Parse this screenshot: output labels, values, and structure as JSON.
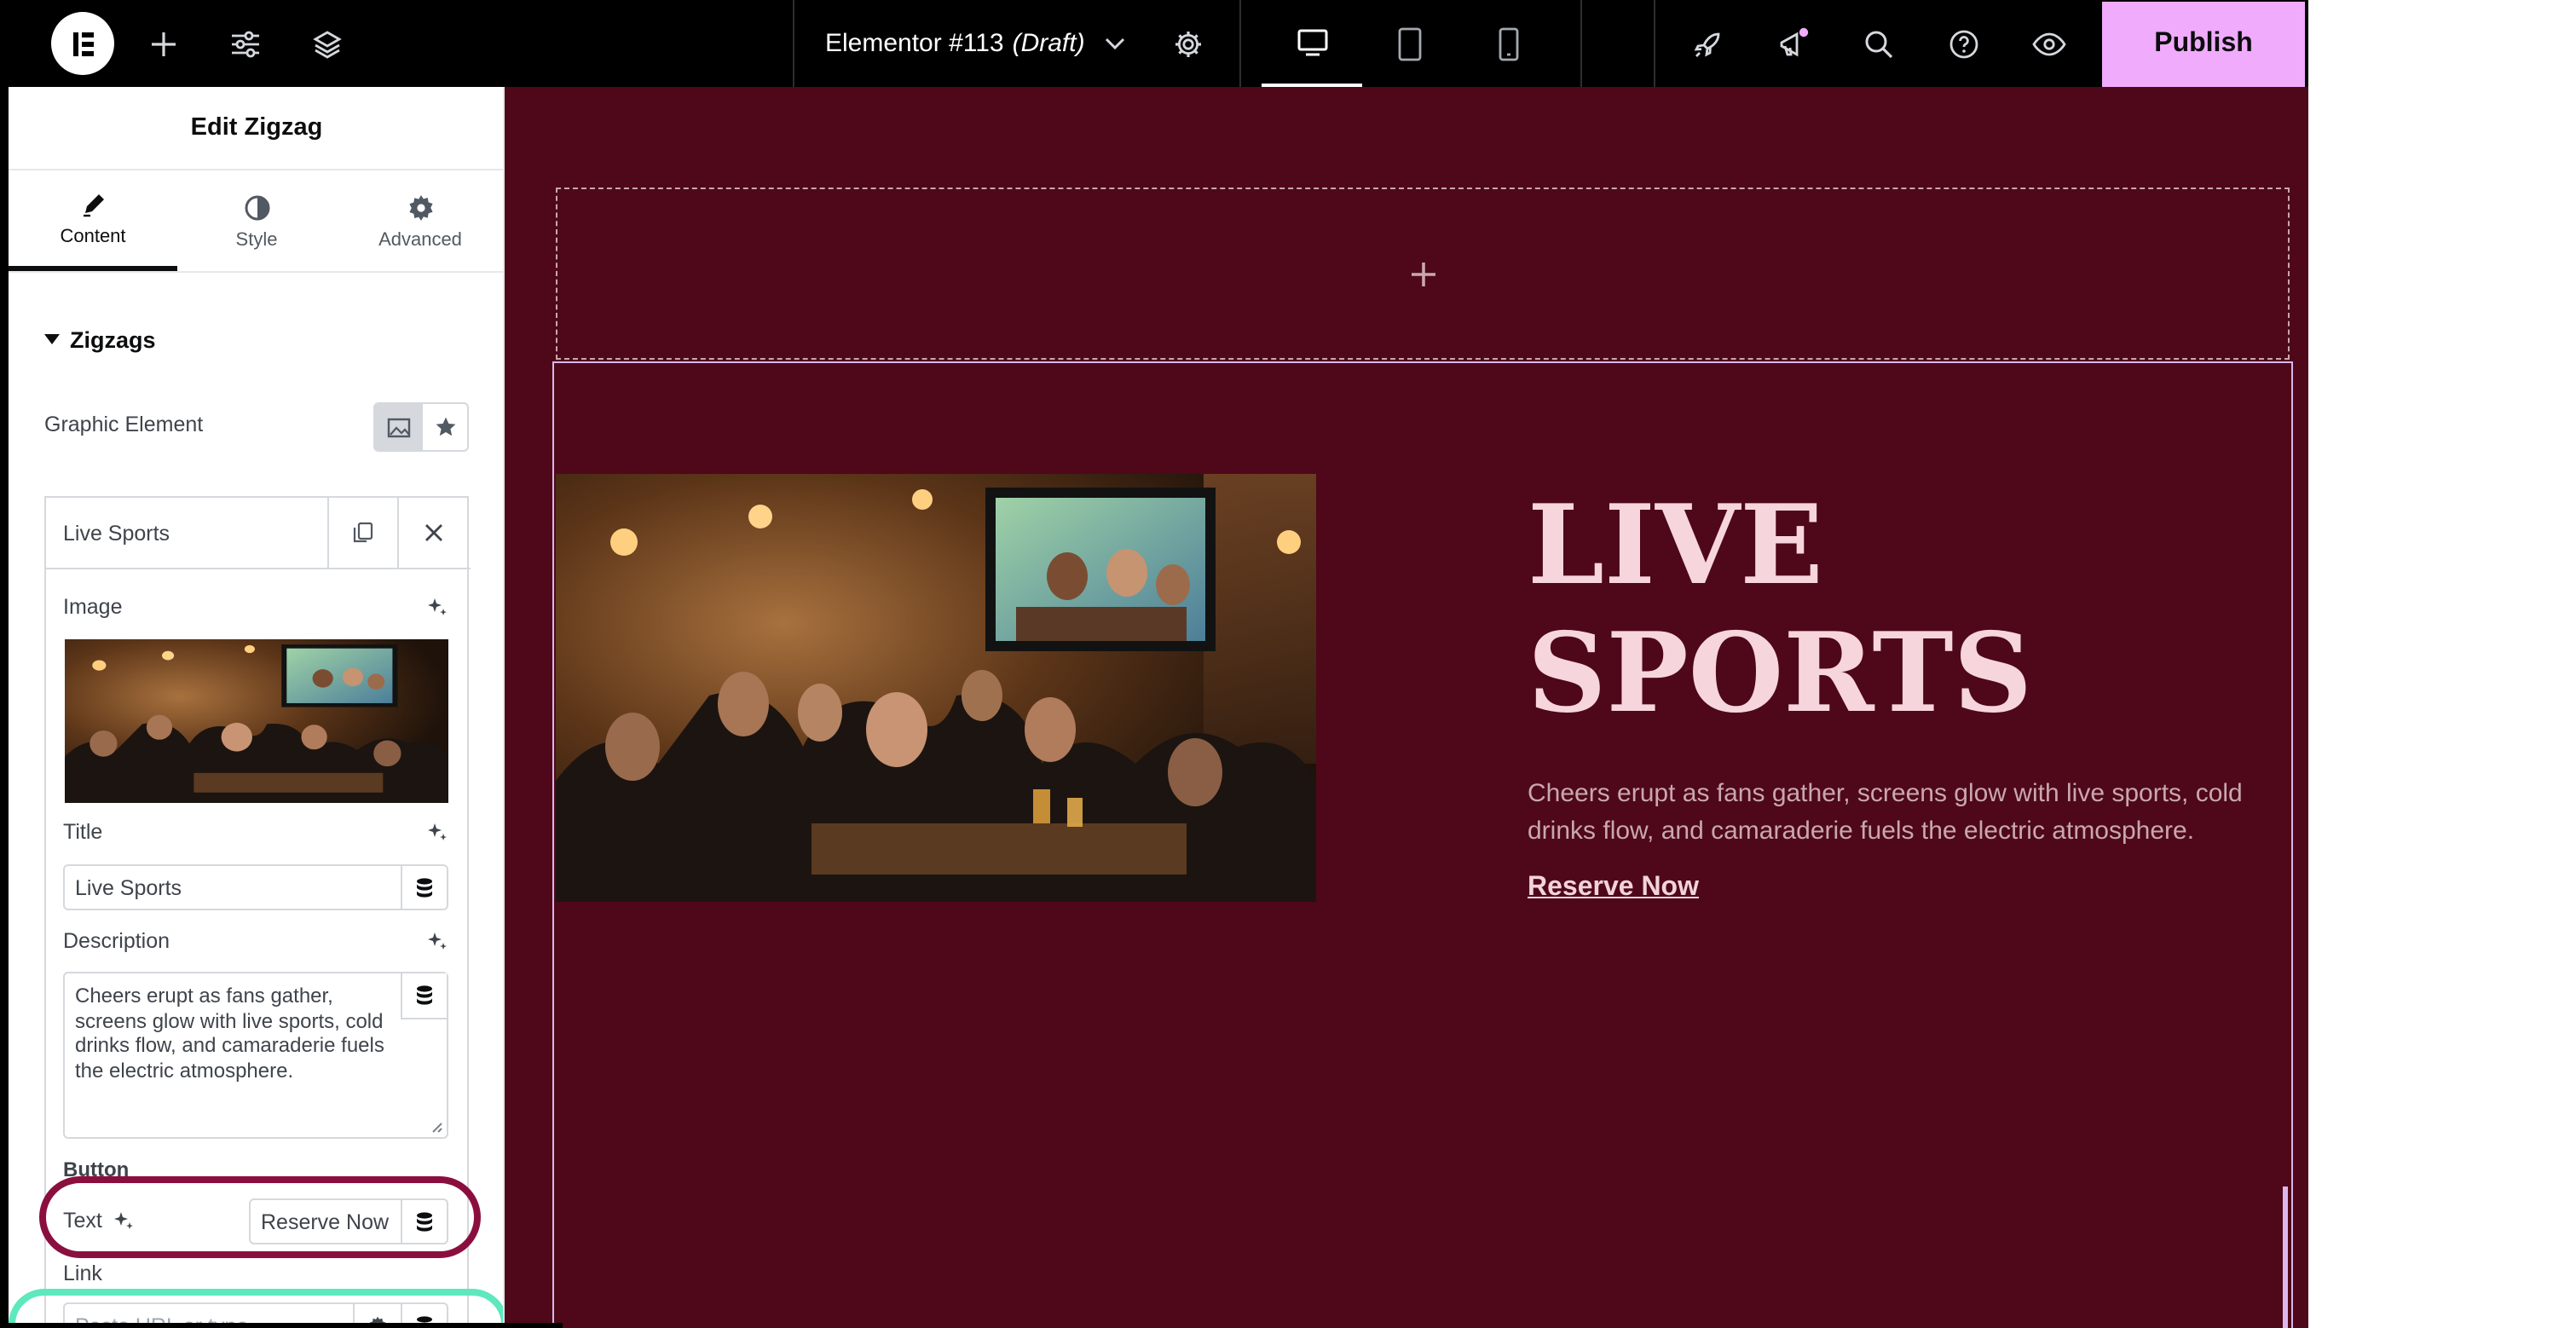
{
  "topbar": {
    "doc_title": "Elementor #113",
    "doc_status": "(Draft)",
    "publish_label": "Publish",
    "colors": {
      "bg": "#000000",
      "publish": "#f0abfc"
    }
  },
  "panel": {
    "title": "Edit Zigzag",
    "tabs": [
      {
        "label": "Content",
        "icon": "pencil-icon",
        "active": true
      },
      {
        "label": "Style",
        "icon": "half-circle-icon",
        "active": false
      },
      {
        "label": "Advanced",
        "icon": "gear-icon",
        "active": false
      }
    ],
    "section_title": "Zigzags",
    "graphic_element_label": "Graphic Element",
    "item": {
      "name": "Live Sports",
      "image_label": "Image",
      "title_label": "Title",
      "title_value": "Live Sports",
      "description_label": "Description",
      "description_value": "Cheers erupt as fans gather, screens glow with live sports, cold drinks flow, and camaraderie fuels the electric atmosphere.",
      "button_heading": "Button",
      "text_label": "Text",
      "text_value": "Reserve Now",
      "link_label": "Link",
      "link_placeholder": "Paste URL or type"
    }
  },
  "canvas": {
    "heading_line1": "LIVE",
    "heading_line2": "SPORTS",
    "description": "Cheers erupt as fans gather, screens glow with live sports, cold drinks flow, and camaraderie fuels the electric atmosphere.",
    "button_label": "Reserve Now",
    "colors": {
      "bg": "#4e0819",
      "heading": "#f7d5dd",
      "text": "#c9a7b0"
    }
  },
  "annotations": {
    "text_field_ring": "#8a0f3f",
    "link_field_ring": "#5ee8bd"
  }
}
